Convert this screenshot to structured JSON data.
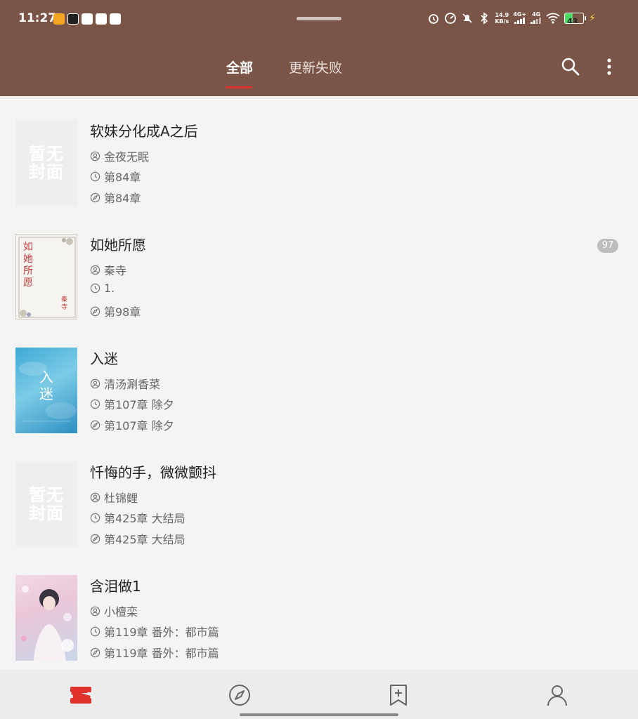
{
  "status_bar": {
    "time": "11:27",
    "net_speed": "14.9",
    "net_unit": "KB/s",
    "signal_1": "4G+",
    "signal_2": "4G",
    "battery": "43"
  },
  "tabs": [
    {
      "label": "全部",
      "active": true
    },
    {
      "label": "更新失败",
      "active": false
    }
  ],
  "books": [
    {
      "title": "软妹分化成A之后",
      "author": "金夜无眠",
      "latest": "第84章",
      "read": "第84章",
      "cover": "placeholder",
      "cover_text": "暂无封面",
      "badge": ""
    },
    {
      "title": "如她所愿",
      "author": "秦寺",
      "latest": "1.",
      "read": "第98章",
      "cover": "paper",
      "cover_text": "如她所愿",
      "cover_author": "秦寺",
      "badge": "97"
    },
    {
      "title": "入迷",
      "author": "清汤涮香菜",
      "latest": "第107章 除夕",
      "read": "第107章 除夕",
      "cover": "blue",
      "cover_text": "入迷",
      "badge": ""
    },
    {
      "title": "忏悔的手，微微颤抖",
      "author": "杜锦鲤",
      "latest": "第425章 大结局",
      "read": "第425章 大结局",
      "cover": "placeholder",
      "cover_text": "暂无封面",
      "badge": ""
    },
    {
      "title": "含泪做1",
      "author": "小檀栾",
      "latest": "第119章 番外：都市篇",
      "read": "第119章 番外：都市篇",
      "cover": "illustration",
      "cover_text": "",
      "badge": ""
    }
  ],
  "colors": {
    "header": "#7a5547",
    "accent": "#e0322c"
  },
  "bottom_nav": [
    "bookshelf-icon",
    "explore-icon",
    "bookmark-add-icon",
    "profile-icon"
  ]
}
